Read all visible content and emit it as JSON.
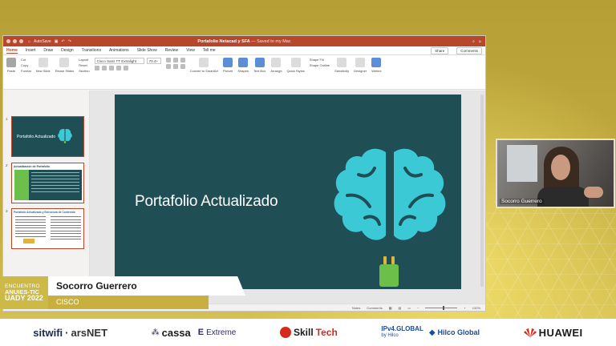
{
  "colors": {
    "ppt_accent": "#b7472a",
    "slide_bg": "#1f4e55",
    "brain": "#3cc9d6",
    "plug": "#6cc04a",
    "gold": "#c7b03f"
  },
  "ppt": {
    "titlebar": {
      "autosave": "AutoSave",
      "doc_title": "Portafolio Netacad y SFA",
      "doc_sub": "— Saved to my Mac",
      "share": "Share",
      "comments": "Comments"
    },
    "tabs": [
      "Home",
      "Insert",
      "Draw",
      "Design",
      "Transitions",
      "Animations",
      "Slide Show",
      "Review",
      "View",
      "Tell me"
    ],
    "ribbon": {
      "paste": "Paste",
      "cut": "Cut",
      "copy": "Copy",
      "format": "Format",
      "new_slide": "New Slide",
      "reuse": "Reuse Slides",
      "layout": "Layout",
      "reset": "Reset",
      "section": "Section",
      "font_name": "Cisco Sans TT Extralight",
      "font_size": "70.4+",
      "convert": "Convert to SmartArt",
      "picture": "Picture",
      "shapes": "Shapes",
      "textbox": "Text Box",
      "arrange": "Arrange",
      "quick_styles": "Quick Styles",
      "shape_fill": "Shape Fill",
      "shape_outline": "Shape Outline",
      "sensitivity": "Sensitivity",
      "designer": "Designer",
      "webex": "Webex"
    },
    "thumbnails": [
      {
        "num": "1",
        "title": "Portafolio Actualizado"
      },
      {
        "num": "2",
        "title": "Actualización de Portafolio"
      },
      {
        "num": "3",
        "title": "Portafolio Actualizado y Estructura de Contenido"
      }
    ],
    "slide": {
      "title": "Portafolio Actualizado"
    },
    "status": {
      "notes": "Notes",
      "comments": "Comments",
      "zoom": "132%"
    }
  },
  "webcam": {
    "name": "Socorro Guerrero"
  },
  "lower_third": {
    "event_line1": "ENCUENTRO",
    "event_line2": "ANUIES-TIC",
    "event_line3": "UADY 2022",
    "speaker": "Socorro Guerrero",
    "org": "CISCO"
  },
  "sponsors": {
    "sitwifi": "sitwifi",
    "arsnet": "arsNET",
    "cassa": "cassa",
    "extreme": "Extreme",
    "skill": "Skill",
    "tech": "Tech",
    "ipv4": "IPv4.GLOBAL",
    "ipv4_by": "by Hilco",
    "hilco": "Hilco Global",
    "huawei": "HUAWEI"
  }
}
